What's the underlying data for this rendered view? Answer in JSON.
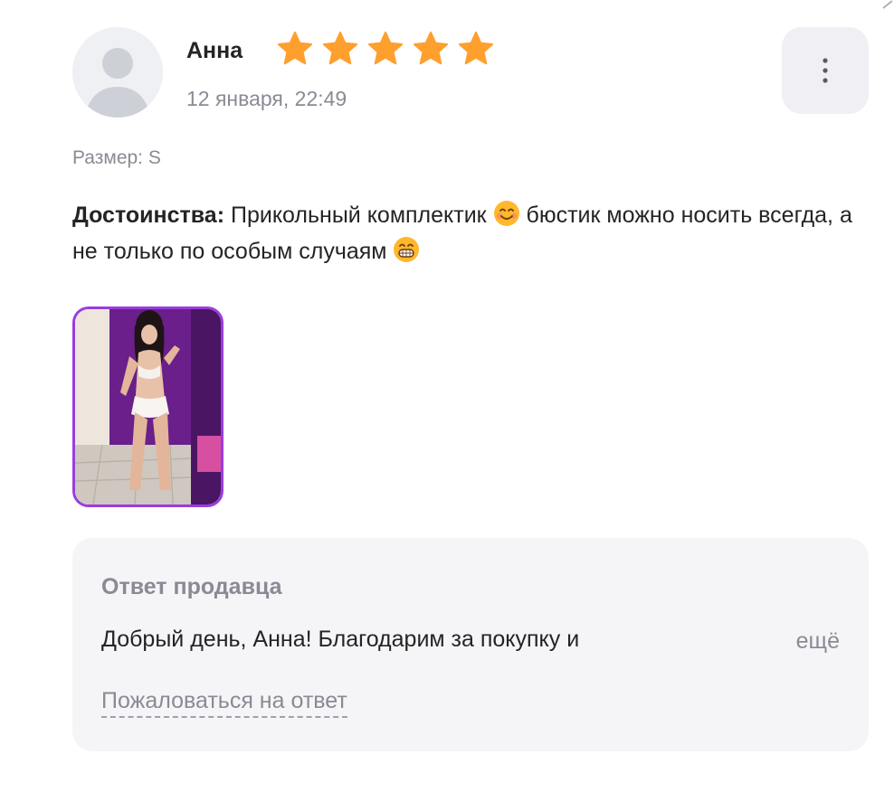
{
  "review": {
    "author": "Анна",
    "rating": 5,
    "rating_max": 5,
    "date": "12 января, 22:49",
    "size": "Размер: S",
    "pros_label": "Достоинства:",
    "pros_text_1": "Прикольный комплектик",
    "pros_text_2": "бюстик можно носить всегда, а не только по особым случаям",
    "emoji_1": "smiling-face-with-smiling-eyes",
    "emoji_2": "grinning-face-with-teeth",
    "photos_count": 1
  },
  "seller_reply": {
    "title": "Ответ продавца",
    "text": "Добрый день, Анна! Благодарим за покупку и",
    "more_label": "ещё",
    "complain_label": "Пожаловаться на ответ"
  },
  "colors": {
    "star": "#ff9f2e",
    "accent_border": "#9a3ce0",
    "muted_text": "#8a8a95",
    "reply_bg": "#f5f5f7"
  }
}
